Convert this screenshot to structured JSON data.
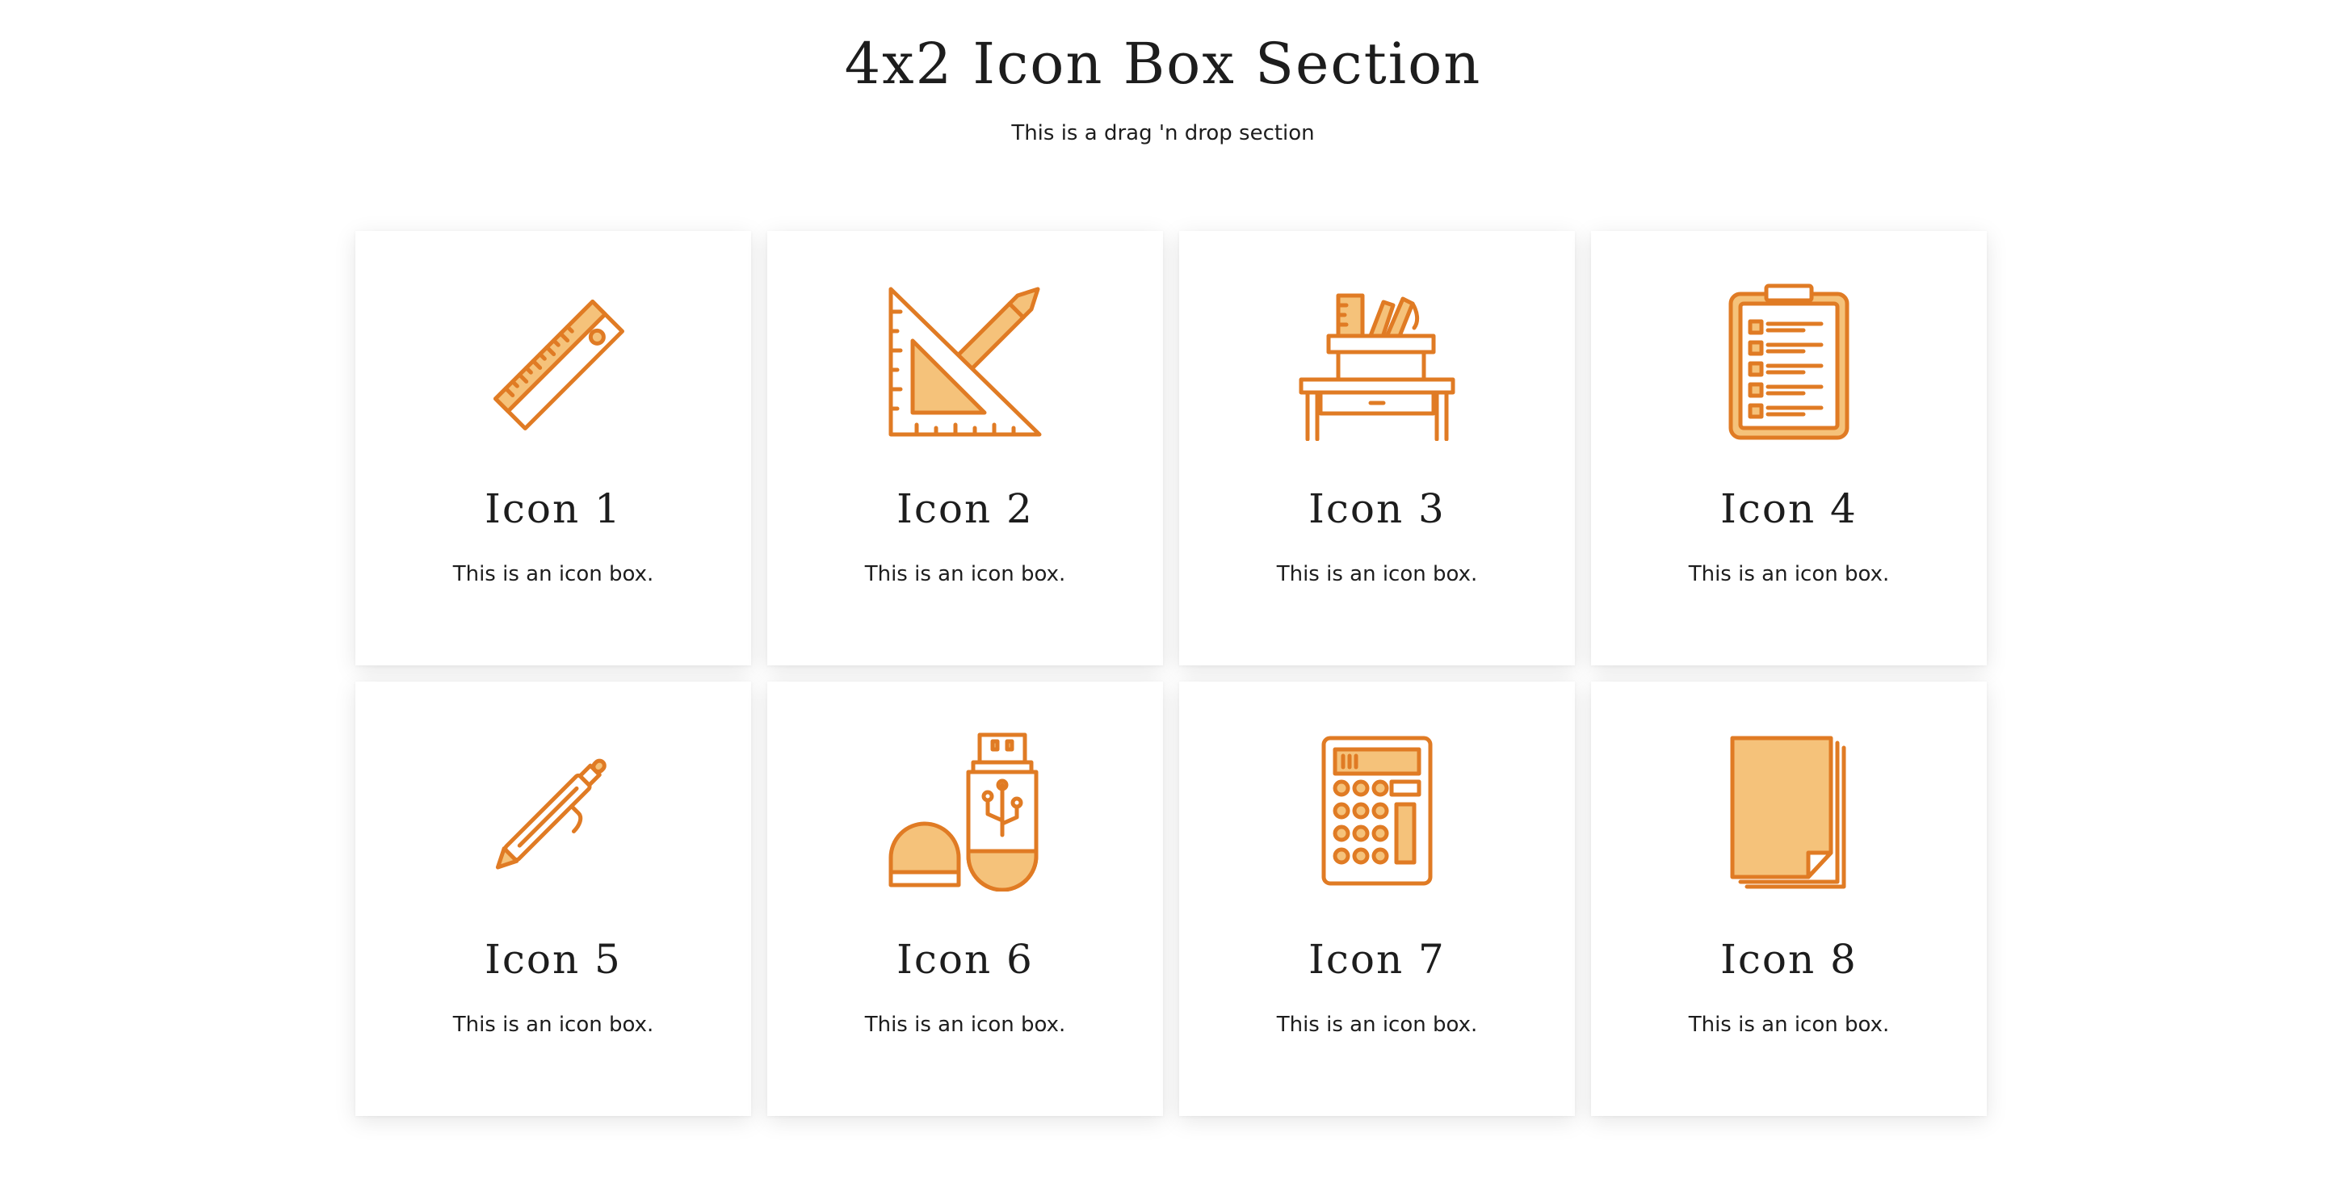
{
  "section": {
    "title": "4x2 Icon Box Section",
    "subtitle": "This is a drag 'n drop section"
  },
  "colors": {
    "icon_stroke": "#E07B24",
    "icon_fill": "#F5C27A"
  },
  "boxes": [
    {
      "icon": "ruler-icon",
      "title": "Icon 1",
      "text": "This is an icon box."
    },
    {
      "icon": "set-square-pencil-icon",
      "title": "Icon 2",
      "text": "This is an icon box."
    },
    {
      "icon": "desk-supplies-icon",
      "title": "Icon 3",
      "text": "This is an icon box."
    },
    {
      "icon": "clipboard-checklist-icon",
      "title": "Icon 4",
      "text": "This is an icon box."
    },
    {
      "icon": "pen-icon",
      "title": "Icon 5",
      "text": "This is an icon box."
    },
    {
      "icon": "usb-drive-icon",
      "title": "Icon 6",
      "text": "This is an icon box."
    },
    {
      "icon": "calculator-icon",
      "title": "Icon 7",
      "text": "This is an icon box."
    },
    {
      "icon": "paper-stack-icon",
      "title": "Icon 8",
      "text": "This is an icon box."
    }
  ]
}
